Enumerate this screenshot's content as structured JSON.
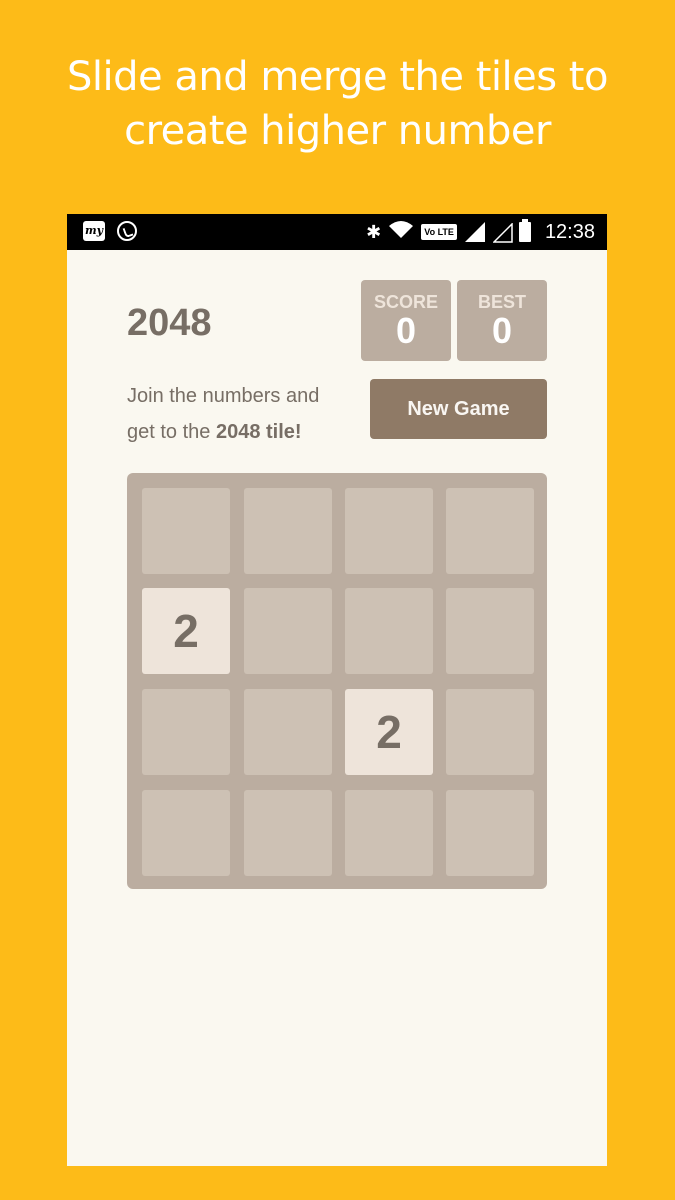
{
  "promo": {
    "headline_line1": "Slide and merge the tiles to",
    "headline_line2": "create higher number",
    "background_color": "#FDBB18"
  },
  "status_bar": {
    "left_icons": [
      "myntra-my-icon",
      "whatsapp-icon"
    ],
    "right_icons": [
      "bluetooth-icon",
      "wifi-icon",
      "volte-badge",
      "signal-full-icon",
      "signal-empty-icon",
      "battery-icon"
    ],
    "volte_label": "Vo LTE",
    "time": "12:38"
  },
  "game": {
    "title": "2048",
    "score_label": "SCORE",
    "score_value": "0",
    "best_label": "BEST",
    "best_value": "0",
    "intro_text": "Join the numbers and",
    "intro_text2_prefix": "get to the ",
    "intro_text2_bold": "2048 tile!",
    "new_game_label": "New Game",
    "board": [
      [
        "",
        "",
        "",
        ""
      ],
      [
        "2",
        "",
        "",
        ""
      ],
      [
        "",
        "",
        "2",
        ""
      ],
      [
        "",
        "",
        "",
        ""
      ]
    ],
    "colors": {
      "board": "#BBADA0",
      "empty_cell": "#CDC1B4",
      "tile_2": "#EEE4DA",
      "text": "#776E65",
      "button": "#8F7A66"
    }
  }
}
